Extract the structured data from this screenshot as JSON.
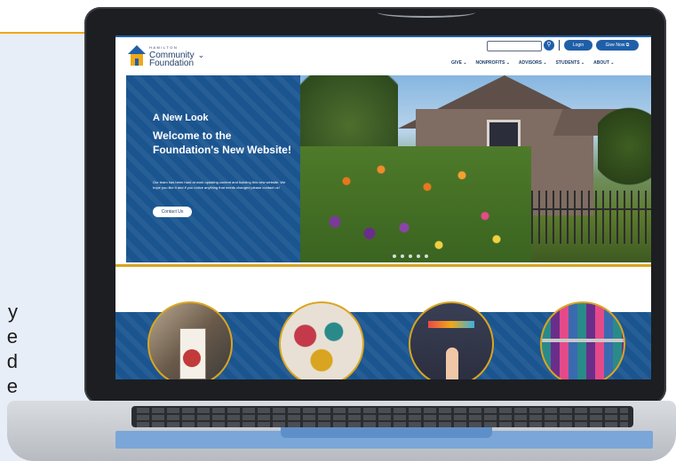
{
  "side_text": [
    "y",
    "e",
    "d",
    "e"
  ],
  "site": {
    "logo": {
      "line1": "HAMILTON",
      "line2": "Community",
      "line3": "Foundation",
      "icon": "house-logo-icon"
    },
    "header": {
      "search_icon": "search-icon",
      "login_label": "Login",
      "give_label": "Give Now ⧉"
    },
    "nav": [
      {
        "label": "GIVE ⌄"
      },
      {
        "label": "NONPROFITS ⌄"
      },
      {
        "label": "ADVISORS ⌄"
      },
      {
        "label": "STUDENTS ⌄"
      },
      {
        "label": "ABOUT ⌄"
      }
    ],
    "hero": {
      "small_title": "A New Look",
      "title": "Welcome to the Foundation's New Website!",
      "body": "Our team has been hard at work updating content and building this new website. We hope you like it and if you notice anything that needs changed please contact us!",
      "cta": "Contact Us",
      "slide_count": 5
    }
  },
  "colors": {
    "brand_blue": "#1b5590",
    "accent_gold": "#d9a520",
    "stripe_orange": "#f0a818"
  }
}
